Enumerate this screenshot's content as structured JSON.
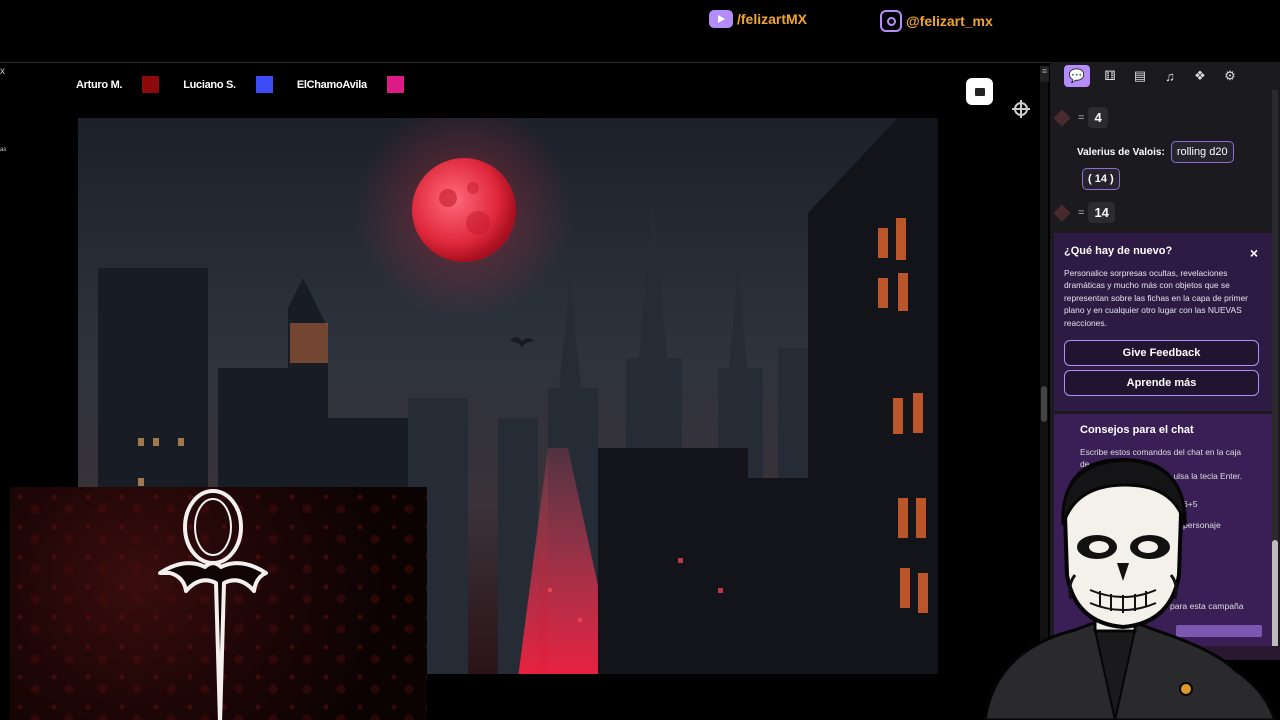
{
  "banner": {
    "youtube": {
      "icon": "youtube-icon",
      "handle": "/felizartMX"
    },
    "instagram": {
      "icon": "instagram-icon",
      "handle": "@felizart_mx"
    }
  },
  "players": [
    {
      "name": "Arturo M.",
      "color": "#8e0a0a"
    },
    {
      "name": "Luciano S.",
      "color": "#3c4bf5"
    },
    {
      "name": "ElChamoAvila",
      "color": "#de1a85"
    }
  ],
  "left_edge": {
    "close": "x",
    "fragment": "as"
  },
  "chat": {
    "toolbar": [
      "chat-icon",
      "dice-icon",
      "journal-icon",
      "music-icon",
      "collections-icon",
      "settings-icon"
    ],
    "prev_result": {
      "eq": "=",
      "value": "4"
    },
    "roll": {
      "sender": "Valerius de Valois:",
      "command": "rolling d20",
      "breakdown": "( 14 )",
      "eq": "=",
      "result": "14"
    }
  },
  "whats_new": {
    "title": "¿Qué hay de nuevo?",
    "close": "×",
    "body": "Personalice sorpresas ocultas, revelaciones dramáticas y mucho más con objetos que se representan sobre las fichas en la capa de primer plano y en cualquier otro lugar con las NUEVAS reacciones.",
    "feedback_button": "Give Feedback",
    "learn_button": "Aprende más"
  },
  "chat_tips": {
    "title": "Consejos para el chat",
    "intro_line1": "Escribe estos comandos del chat en la caja de",
    "intro_line2_start": "text",
    "intro_line2_end": "ulsa la tecla Enter.",
    "frag_dice": "6+5",
    "frag_character": "personaje",
    "frag_campaign": "para esta campaña"
  },
  "colors": {
    "accent": "#b48dfb",
    "banner_text": "#f3a52b",
    "moon": "#e0283c",
    "panel_news": "#2d1b44",
    "panel_tips": "#3a1f56"
  }
}
